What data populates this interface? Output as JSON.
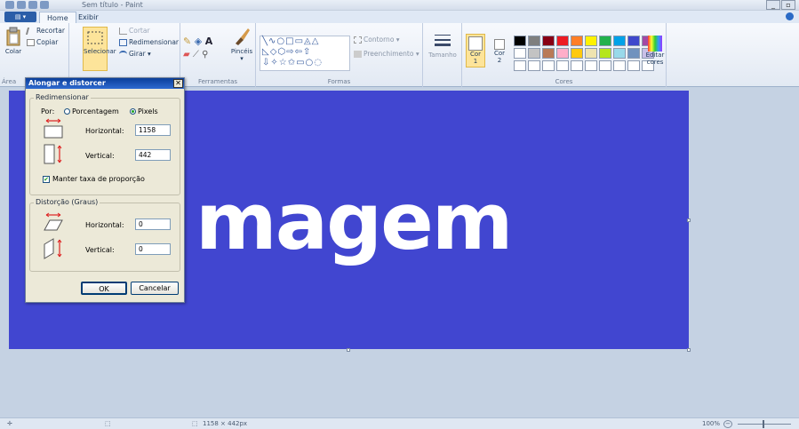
{
  "window": {
    "title": "Sem título - Paint"
  },
  "tabs": [
    {
      "label": "Home"
    },
    {
      "label": "Exibir"
    }
  ],
  "ribbon": {
    "clipboard": {
      "paste": "Colar",
      "cut": "Recortar",
      "copy": "Copiar",
      "group": "Área"
    },
    "image": {
      "select": "Selecionar",
      "crop": "Cortar",
      "resize": "Redimensionar",
      "rotate": "Girar"
    },
    "tools": {
      "group": "Ferramentas",
      "brushes": "Pincéis"
    },
    "shapes": {
      "outline": "Contorno",
      "fill": "Preenchimento",
      "group": "Formas"
    },
    "size": {
      "label": "Tamanho"
    },
    "colors": {
      "color1": "Cor",
      "color1_num": "1",
      "color2": "Cor",
      "color2_num": "2",
      "edit": "Editar",
      "edit2": "cores",
      "group": "Cores",
      "palette": [
        "#000000",
        "#7f7f7f",
        "#880015",
        "#ed1c24",
        "#ff7f27",
        "#fff200",
        "#22b14c",
        "#00a2e8",
        "#3f48cc",
        "#a349a4",
        "#ffffff",
        "#c3c3c3",
        "#b97a57",
        "#ffaec9",
        "#ffc90e",
        "#efe4b0",
        "#b5e61d",
        "#99d9ea",
        "#7092be",
        "#c8bfe7",
        "#ffffff",
        "#ffffff",
        "#ffffff",
        "#ffffff",
        "#ffffff",
        "#ffffff",
        "#ffffff",
        "#ffffff",
        "#ffffff",
        "#ffffff"
      ]
    }
  },
  "canvas": {
    "text": "magem",
    "color": "#4146d0"
  },
  "dialog": {
    "title": "Alongar e distorcer",
    "resize_group": "Redimensionar",
    "by": "Por:",
    "percent": "Porcentagem",
    "pixels": "Pixels",
    "horizontal": "Horizontal:",
    "vertical": "Vertical:",
    "h_value": "1158",
    "v_value": "442",
    "keep_ratio": "Manter taxa de proporção",
    "skew_group": "Distorção (Graus)",
    "skew_h_label": "Horizontal:",
    "skew_v_label": "Vertical:",
    "skew_h": "0",
    "skew_v": "0",
    "ok": "OK",
    "cancel": "Cancelar"
  },
  "status": {
    "size": "1158 × 442px",
    "zoom": "100%"
  }
}
